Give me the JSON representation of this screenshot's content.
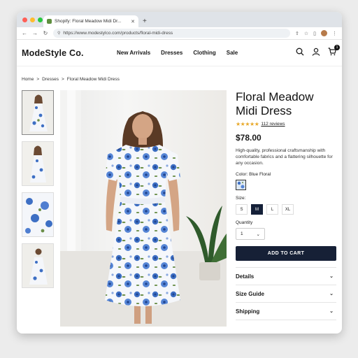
{
  "browser": {
    "tab_title": "Shopify: Floral Meadow Midi Dr...",
    "tab_close": "✕",
    "new_tab": "+",
    "url": "https://www.modestylco.com/products/floral-midi-dress"
  },
  "site": {
    "logo": "ModeStyle Co.",
    "nav": [
      "New Arrivals",
      "Dresses",
      "Clothing",
      "Sale"
    ],
    "cart_count": "1"
  },
  "breadcrumb": [
    "Home",
    ">",
    "Dresses",
    ">",
    "Floral Meadow Midi Dress"
  ],
  "product": {
    "title": "Floral Meadow Midi Dress",
    "stars": "★★★★★",
    "reviews": "112 reviews",
    "price": "$78.00",
    "description": "High-quality, professional craftsmanship with comfortable fabrics and a flattering silhouette for any occasion.",
    "color_label": "Color: Blue Floral",
    "size_label": "Size:",
    "sizes": [
      "S",
      "M",
      "L",
      "XL"
    ],
    "selected_size": "M",
    "quantity_label": "Quantity",
    "quantity_value": "1",
    "add_to_cart": "ADD TO CART",
    "accordion": [
      "Details",
      "Size Guide",
      "Shipping"
    ]
  },
  "colors": {
    "accent": "#162036",
    "star": "#e8a92b",
    "dress_blue": "#3d6fc4"
  }
}
